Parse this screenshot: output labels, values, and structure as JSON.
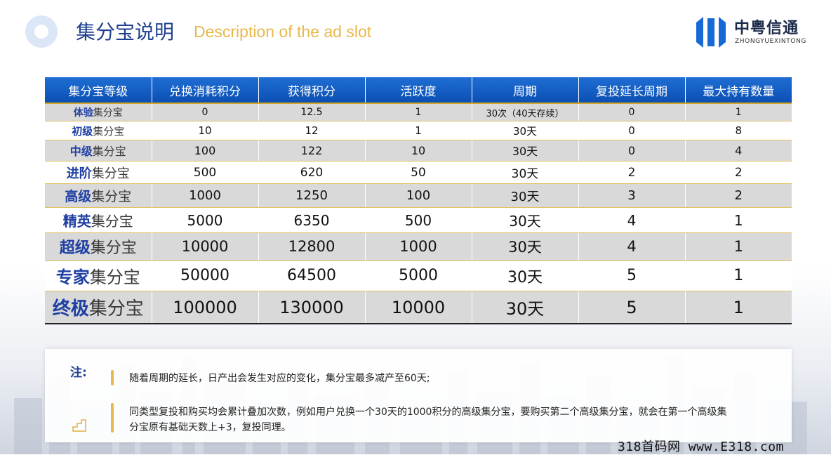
{
  "header": {
    "title_cn": "集分宝说明",
    "title_en": "Description of the ad slot"
  },
  "logo": {
    "name": "中粤信通",
    "subtitle": "ZHONGYUEXINTONG"
  },
  "table": {
    "columns": [
      "集分宝等级",
      "兑换消耗积分",
      "获得积分",
      "活跃度",
      "周期",
      "复投延长周期",
      "最大持有数量"
    ],
    "rows": [
      {
        "level_hl": "体验",
        "level_rest": "集分宝",
        "cells": [
          "0",
          "12.5",
          "1",
          "30次（40天存续）",
          "0",
          "1"
        ]
      },
      {
        "level_hl": "初级",
        "level_rest": "集分宝",
        "cells": [
          "10",
          "12",
          "1",
          "30天",
          "0",
          "8"
        ]
      },
      {
        "level_hl": "中级",
        "level_rest": "集分宝",
        "cells": [
          "100",
          "122",
          "10",
          "30天",
          "0",
          "4"
        ]
      },
      {
        "level_hl": "进阶",
        "level_rest": "集分宝",
        "cells": [
          "500",
          "620",
          "50",
          "30天",
          "2",
          "2"
        ]
      },
      {
        "level_hl": "高级",
        "level_rest": "集分宝",
        "cells": [
          "1000",
          "1250",
          "100",
          "30天",
          "3",
          "2"
        ]
      },
      {
        "level_hl": "精英",
        "level_rest": "集分宝",
        "cells": [
          "5000",
          "6350",
          "500",
          "30天",
          "4",
          "1"
        ]
      },
      {
        "level_hl": "超级",
        "level_rest": "集分宝",
        "cells": [
          "10000",
          "12800",
          "1000",
          "30天",
          "4",
          "1"
        ]
      },
      {
        "level_hl": "专家",
        "level_rest": "集分宝",
        "cells": [
          "50000",
          "64500",
          "5000",
          "30天",
          "5",
          "1"
        ]
      },
      {
        "level_hl": "终极",
        "level_rest": "集分宝",
        "cells": [
          "100000",
          "130000",
          "10000",
          "30天",
          "5",
          "1"
        ]
      }
    ]
  },
  "notes": {
    "label": "注:",
    "items": [
      "随着周期的延长，日产出会发生对应的变化，集分宝最多减产至60天;",
      "同类型复投和购买均会累计叠加次数，例如用户兑换一个30天的1000积分的高级集分宝，要购买第二个高级集分宝，就会在第一个高级集分宝原有基础天数上+3，复投同理。"
    ]
  },
  "watermark": "318首码网 www.E318.com",
  "colors": {
    "title": "#1f3f8f",
    "accent": "#e8b84a",
    "header_blue": "#0b4fb3",
    "row_gray": "#d9d9d9"
  }
}
